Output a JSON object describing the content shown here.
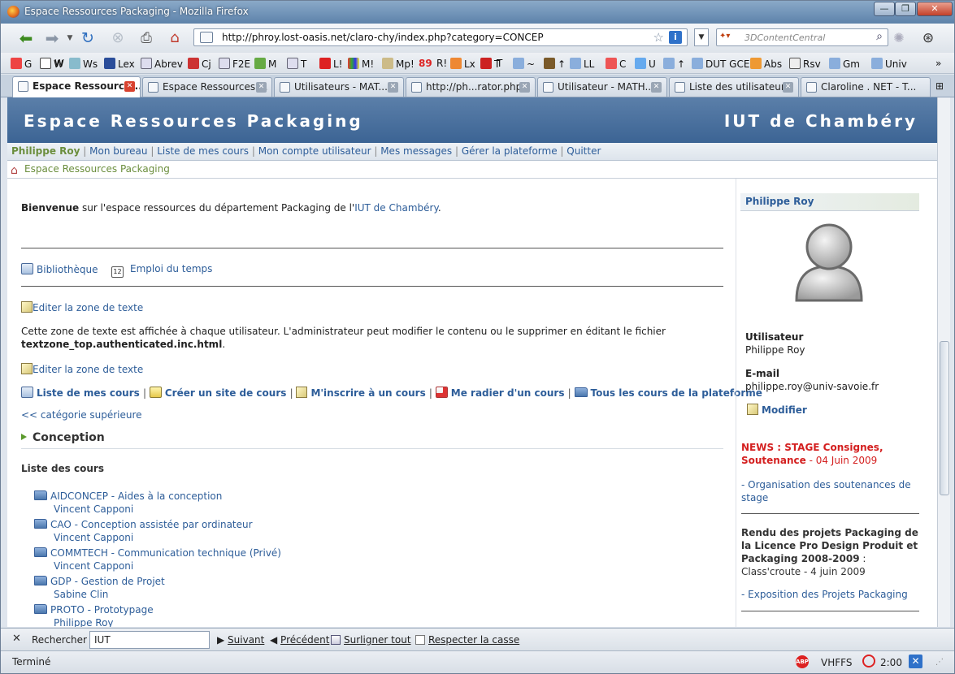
{
  "window": {
    "title": "Espace Ressources Packaging - Mozilla Firefox"
  },
  "nav": {
    "url": "http://phroy.lost-oasis.net/claro-chy/index.php?category=CONCEP",
    "search_placeholder": "3DContentCentral"
  },
  "bookmarks": [
    "G",
    "W",
    "W",
    "Ws",
    "Lex",
    "Abrev",
    "Cj",
    "F2E",
    "M",
    "T",
    "L!",
    "M!",
    "Mp!",
    "89",
    "R!",
    "Lx",
    "T",
    "T",
    "~",
    "↑",
    "LL",
    "C",
    "U",
    "↑",
    "DUT GCE",
    "Abs",
    "Rsv",
    "Gm",
    "Univ",
    "»"
  ],
  "tabs": [
    "Espace Ressource...",
    "Espace Ressources ...",
    "Utilisateurs - MAT...",
    "http://ph...rator.php",
    "Utilisateur - MATH...",
    "Liste des utilisateur...",
    "Claroline . NET - T..."
  ],
  "banner": {
    "left": "Espace Ressources Packaging",
    "right": "IUT de Chambéry"
  },
  "userbar": {
    "name": "Philippe Roy",
    "links": [
      "Mon bureau",
      "Liste de mes cours",
      "Mon compte utilisateur",
      "Mes messages",
      "Gérer la plateforme",
      "Quitter"
    ]
  },
  "breadcrumb": "Espace Ressources Packaging",
  "main": {
    "welcome_bold": "Bienvenue",
    "welcome_text": " sur l'espace ressources du département Packaging de l'",
    "welcome_link": "IUT de Chambéry",
    "welcome_end": ".",
    "library": "Bibliothèque",
    "timetable": "Emploi du temps",
    "edit_text": "Editer la zone de texte",
    "zone_text": "Cette zone de texte est affichée à chaque utilisateur. L'administrateur peut modifier le contenu ou le supprimer en éditant le fichier",
    "zone_file": "textzone_top.authenticated.inc.html",
    "zone_end": ".",
    "actions": [
      "Liste de mes cours",
      "Créer un site de cours",
      "M'inscrire à un cours",
      "Me radier d'un cours",
      "Tous les cours de la plateforme"
    ],
    "parent_category": "<< catégorie supérieure",
    "category": "Conception",
    "course_list_title": "Liste des cours",
    "courses": [
      {
        "title": "AIDCONCEP - Aides à la conception",
        "teacher": "Vincent Capponi"
      },
      {
        "title": "CAO - Conception assistée par ordinateur",
        "teacher": "Vincent Capponi"
      },
      {
        "title": "COMMTECH - Communication technique (Privé)",
        "teacher": "Vincent Capponi"
      },
      {
        "title": "GDP - Gestion de Projet",
        "teacher": "Sabine Clin"
      },
      {
        "title": "PROTO - Prototypage",
        "teacher": "Philippe Roy"
      }
    ]
  },
  "side": {
    "name": "Philippe Roy",
    "user_label": "Utilisateur",
    "user_value": "Philippe Roy",
    "email_label": "E-mail",
    "email_value": "philippe.roy@univ-savoie.fr",
    "modify": "Modifier",
    "news_title": "NEWS : STAGE Consignes, Soutenance",
    "news_date": " - 04 Juin 2009",
    "news_link": "- Organisation des soutenances de stage",
    "rendu_bold": "Rendu des projets Packaging de la Licence Pro Design Produit et Packaging 2008-2009",
    "rendu_text": " : Class'croute - 4 juin 2009",
    "expo_link": "- Exposition des Projets Packaging"
  },
  "findbar": {
    "label": "Rechercher :",
    "value": "IUT",
    "next": "Suivant",
    "prev": "Précédent",
    "highlight": "Surligner tout",
    "match_case": "Respecter la casse"
  },
  "status": {
    "text": "Terminé",
    "vhffs": "VHFFS",
    "time": "2:00"
  }
}
